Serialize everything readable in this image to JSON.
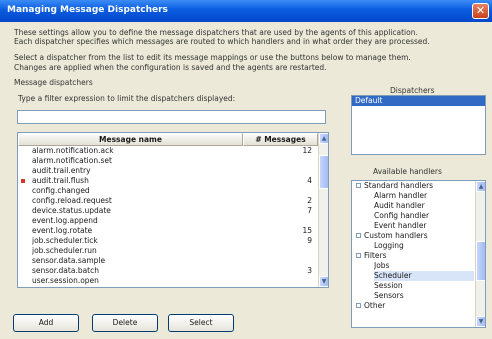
{
  "window": {
    "title": "Managing Message Dispatchers",
    "close_symbol": "✕",
    "accent_color": "#0a5ce0"
  },
  "description": {
    "line1": "These settings allow you to define the message dispatchers that are used by the agents of this application.",
    "line2": "Each dispatcher specifies which messages are routed to which handlers and in what order they are processed.",
    "line3": "Select a dispatcher from the list to edit its message mappings or use the buttons below to manage them.",
    "line4": "Changes are applied when the configuration is saved and the agents are restarted."
  },
  "section": {
    "label": "Message dispatchers",
    "hint": "Type a filter expression to limit the dispatchers displayed:"
  },
  "filter": {
    "value": "",
    "placeholder": ""
  },
  "table": {
    "col_name": "Message name",
    "col_count": "# Messages",
    "rows": [
      {
        "name": "alarm.notification.ack",
        "count": "12",
        "marked": false
      },
      {
        "name": "alarm.notification.set",
        "count": "",
        "marked": false
      },
      {
        "name": "audit.trail.entry",
        "count": "",
        "marked": false
      },
      {
        "name": "audit.trail.flush",
        "count": "4",
        "marked": true
      },
      {
        "name": "config.changed",
        "count": "",
        "marked": false
      },
      {
        "name": "config.reload.request",
        "count": "2",
        "marked": false
      },
      {
        "name": "device.status.update",
        "count": "7",
        "marked": false
      },
      {
        "name": "event.log.append",
        "count": "",
        "marked": false
      },
      {
        "name": "event.log.rotate",
        "count": "15",
        "marked": false
      },
      {
        "name": "job.scheduler.tick",
        "count": "9",
        "marked": false
      },
      {
        "name": "job.scheduler.run",
        "count": "",
        "marked": false
      },
      {
        "name": "sensor.data.sample",
        "count": "",
        "marked": false
      },
      {
        "name": "sensor.data.batch",
        "count": "3",
        "marked": false
      },
      {
        "name": "user.session.open",
        "count": "",
        "marked": false
      }
    ]
  },
  "buttons": {
    "add": "Add",
    "delete": "Delete",
    "select": "Select"
  },
  "right_panel": {
    "top_label": "Dispatchers",
    "selected_item": "Default",
    "mid_label": "Available handlers",
    "tree": [
      {
        "label": "Standard handlers",
        "level": 0,
        "expander": true,
        "highlight": false
      },
      {
        "label": "Alarm handler",
        "level": 1,
        "expander": false,
        "highlight": false
      },
      {
        "label": "Audit handler",
        "level": 1,
        "expander": false,
        "highlight": false
      },
      {
        "label": "Config handler",
        "level": 1,
        "expander": false,
        "highlight": false
      },
      {
        "label": "Event handler",
        "level": 1,
        "expander": false,
        "highlight": false
      },
      {
        "label": "Custom handlers",
        "level": 0,
        "expander": true,
        "highlight": false
      },
      {
        "label": "Logging",
        "level": 1,
        "expander": false,
        "highlight": false
      },
      {
        "label": "Filters",
        "level": 0,
        "expander": true,
        "highlight": false
      },
      {
        "label": "Jobs",
        "level": 1,
        "expander": false,
        "highlight": false
      },
      {
        "label": "Scheduler",
        "level": 1,
        "expander": false,
        "highlight": true
      },
      {
        "label": "Session",
        "level": 1,
        "expander": false,
        "highlight": false
      },
      {
        "label": "Sensors",
        "level": 1,
        "expander": false,
        "highlight": false
      },
      {
        "label": "Other",
        "level": 0,
        "expander": true,
        "highlight": false
      }
    ]
  }
}
